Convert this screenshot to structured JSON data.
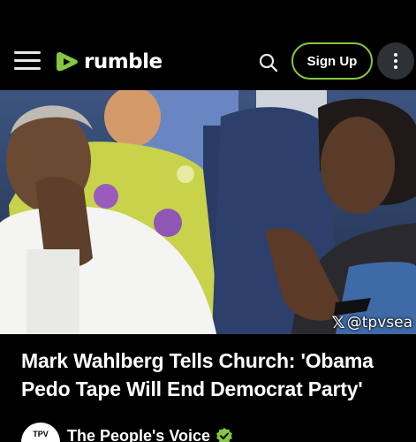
{
  "header": {
    "logo_text": "rumble",
    "signup_label": "Sign Up",
    "brand_color": "#85c742"
  },
  "video": {
    "watermark": "@tpvsea",
    "title": "Mark Wahlberg Tells Church: 'Obama Pedo Tape Will End Democrat Party'"
  },
  "channel": {
    "name": "The People's Voice",
    "avatar_text": "TPV",
    "verified": true
  }
}
